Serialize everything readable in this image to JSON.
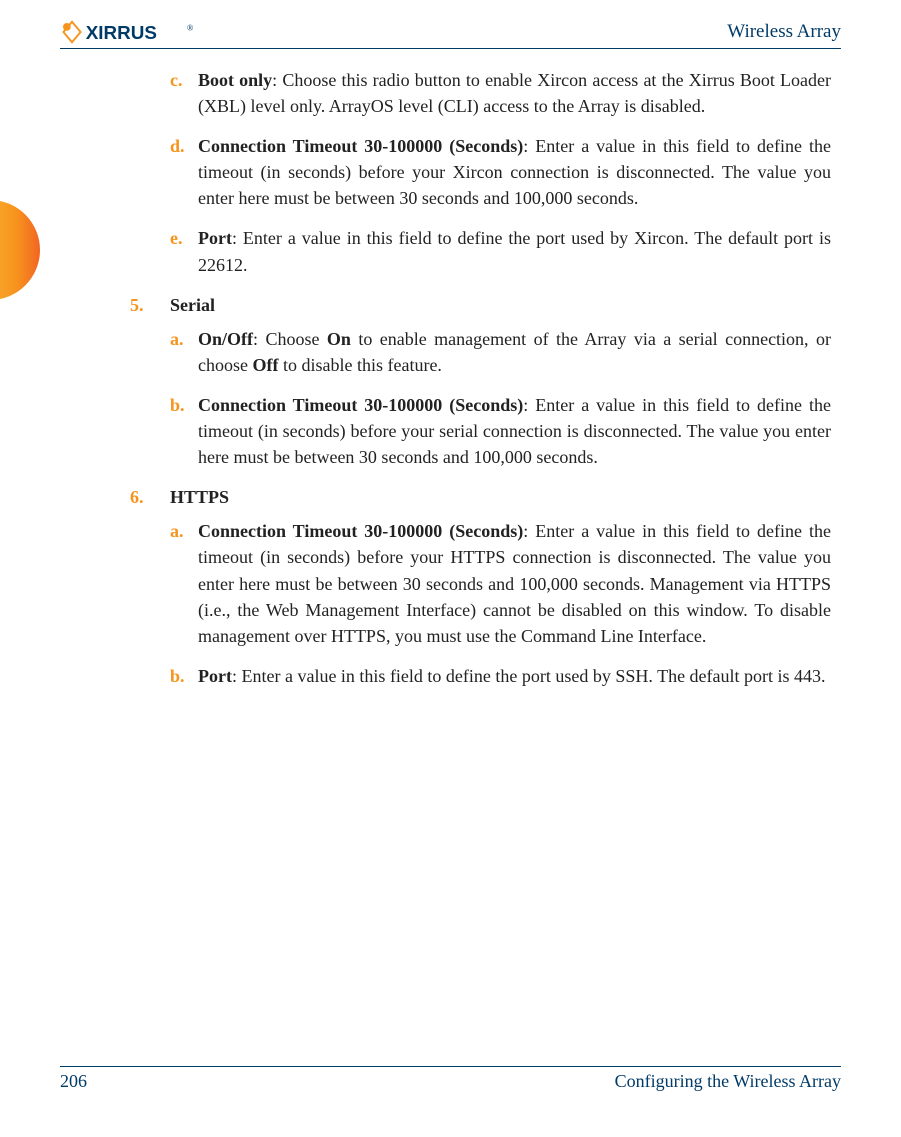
{
  "header": {
    "title": "Wireless Array",
    "logo_alt": "XIRRUS"
  },
  "footer": {
    "page": "206",
    "section": "Configuring the Wireless Array"
  },
  "items": {
    "c": {
      "marker": "c.",
      "lead": "Boot only",
      "body": ": Choose this radio button to enable Xircon access at the Xirrus Boot Loader (XBL) level only. ArrayOS level (CLI) access to the Array is disabled."
    },
    "d": {
      "marker": "d.",
      "lead": "Connection Timeout 30-100000 (Seconds)",
      "body": ": Enter a value in this field to define the timeout (in seconds) before your Xircon connection is disconnected. The value you enter here must be between 30 seconds and 100,000 seconds."
    },
    "e": {
      "marker": "e.",
      "lead": "Port",
      "body": ": Enter a value in this field to define the port used by Xircon. The default port is 22612."
    },
    "n5": {
      "marker": "5.",
      "title": "Serial"
    },
    "a5": {
      "marker": "a.",
      "lead": "On/Off",
      "body_pre": ": Choose ",
      "body_on": "On",
      "body_mid": " to enable management of the Array via a serial connection, or choose ",
      "body_off": "Off",
      "body_post": " to disable this feature."
    },
    "b5": {
      "marker": "b.",
      "lead": "Connection Timeout 30-100000 (Seconds)",
      "body": ": Enter a value in this field to define the timeout (in seconds) before your serial connection is disconnected. The value you enter here must be between 30 seconds and 100,000 seconds."
    },
    "n6": {
      "marker": "6.",
      "title": "HTTPS"
    },
    "a6": {
      "marker": "a.",
      "lead": "Connection Timeout 30-100000 (Seconds)",
      "body": ": Enter a value in this field to define the timeout (in seconds) before your HTTPS connection is disconnected. The value you enter here must be between 30 seconds and 100,000 seconds. Management via HTTPS (i.e., the Web Management Interface) cannot be disabled on this window. To disable management over HTTPS, you must use the Command Line Interface."
    },
    "b6": {
      "marker": "b.",
      "lead": "Port",
      "body": ": Enter a value in this field to define the port used by SSH. The default port is 443."
    }
  }
}
